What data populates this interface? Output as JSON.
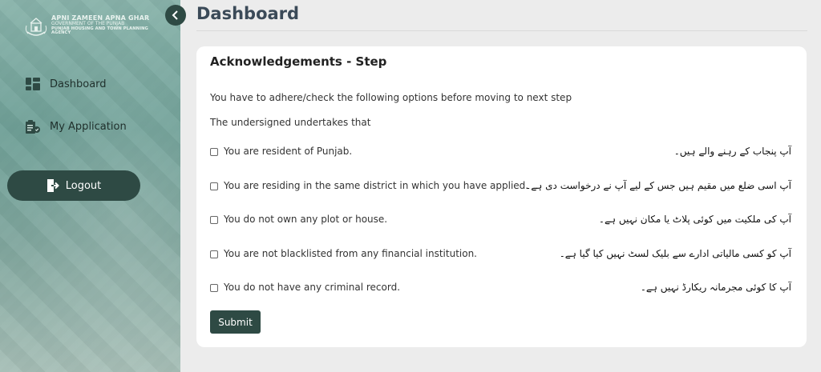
{
  "brand": {
    "line1": "APNI ZAMEEN APNA GHAR",
    "line2": "GOVERNMENT OF THE PUNJAB",
    "line3": "PUNJAB HOUSING AND TOWN PLANNING AGENCY"
  },
  "sidebar": {
    "items": [
      {
        "label": "Dashboard",
        "icon": "dashboard-icon"
      },
      {
        "label": "My Application",
        "icon": "application-icon"
      }
    ],
    "logout_label": "Logout",
    "collapse_icon": "chevron-left-icon"
  },
  "header": {
    "title": "Dashboard"
  },
  "card": {
    "title": "Acknowledgements - Step",
    "intro": "You have to adhere/check the following options before moving to next step",
    "undertake": "The undersigned undertakes that",
    "items": [
      {
        "en": "You are resident of Punjab.",
        "ur": "آپ پنجاب کے رہنے والے ہیں۔",
        "checked": false
      },
      {
        "en": "You are residing in the same district in which you have applied.",
        "ur": "آپ اسی ضلع میں مقیم ہیں جس کے لیے آپ نے درخواست دی ہے۔",
        "checked": false
      },
      {
        "en": "You do not own any plot or house.",
        "ur": "آپ کی ملکیت میں کوئی پلاٹ یا مکان نہیں ہے۔",
        "checked": false
      },
      {
        "en": "You are not blacklisted from any financial institution.",
        "ur": "آپ کو کسی مالیاتی ادارے سے بلیک لسٹ نہیں کیا گیا ہے۔",
        "checked": false
      },
      {
        "en": "You do not have any criminal record.",
        "ur": "آپ کا کوئی مجرمانہ ریکارڈ نہیں ہے۔",
        "checked": false
      }
    ],
    "submit_label": "Submit"
  },
  "colors": {
    "primary": "#2e4a44",
    "sidebar_bg": "#6f9d93",
    "page_bg": "#ececec",
    "title_text": "#3b4a58"
  }
}
